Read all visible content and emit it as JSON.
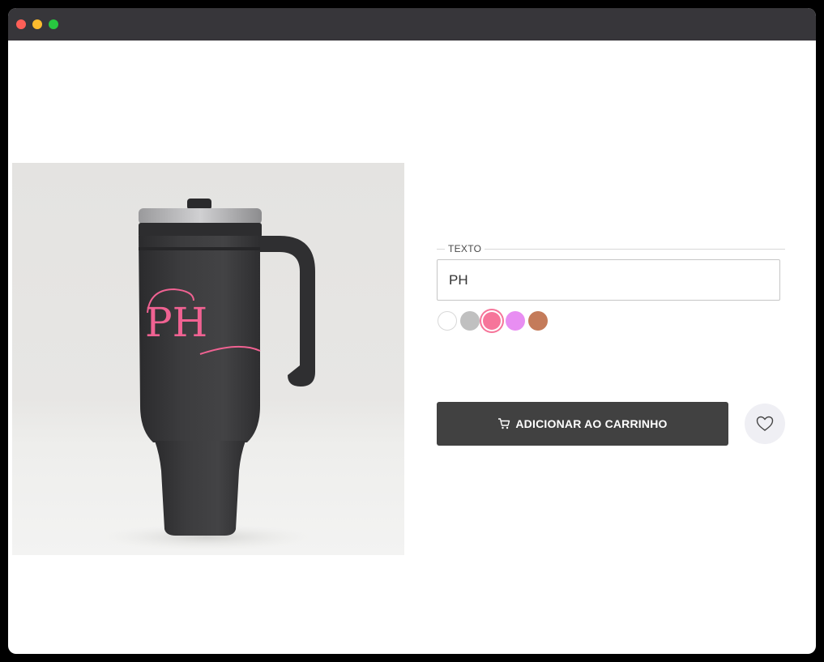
{
  "window": {
    "controls": [
      "close",
      "minimize",
      "maximize"
    ],
    "colors": {
      "close": "#fe5f57",
      "minimize": "#febc2e",
      "maximize": "#28c840",
      "titlebar": "#37363a"
    }
  },
  "product": {
    "image_alt": "Black tumbler with handle, monogram PH in pink",
    "monogram": "PH",
    "monogram_color": "#f06292"
  },
  "personalization": {
    "legend": "TEXTO",
    "text_value": "PH",
    "colors": [
      {
        "name": "white",
        "hex": "#ffffff",
        "selected": false
      },
      {
        "name": "gray",
        "hex": "#c0c0c0",
        "selected": false
      },
      {
        "name": "pink",
        "hex": "#f6759a",
        "selected": true
      },
      {
        "name": "lilac",
        "hex": "#e88ef2",
        "selected": false
      },
      {
        "name": "copper",
        "hex": "#c47b5a",
        "selected": false
      }
    ]
  },
  "actions": {
    "add_to_cart_label": "ADICIONAR AO CARRINHO",
    "add_to_cart_icon": "cart-icon",
    "wishlist_icon": "heart-icon",
    "button_color": "#414141"
  }
}
